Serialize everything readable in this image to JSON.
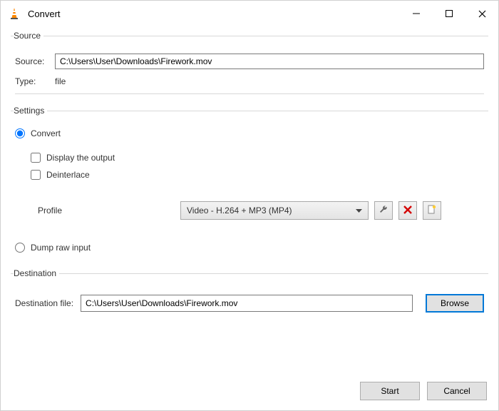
{
  "window": {
    "title": "Convert"
  },
  "source": {
    "legend": "Source",
    "source_label": "Source:",
    "source_value": "C:\\Users\\User\\Downloads\\Firework.mov",
    "type_label": "Type:",
    "type_value": "file"
  },
  "settings": {
    "legend": "Settings",
    "convert_label": "Convert",
    "display_output_label": "Display the output",
    "deinterlace_label": "Deinterlace",
    "profile_label": "Profile",
    "profile_value": "Video - H.264 + MP3 (MP4)",
    "dump_label": "Dump raw input"
  },
  "destination": {
    "legend": "Destination",
    "file_label": "Destination file:",
    "file_value": "C:\\Users\\User\\Downloads\\Firework.mov",
    "browse_label": "Browse"
  },
  "footer": {
    "start_label": "Start",
    "cancel_label": "Cancel"
  }
}
